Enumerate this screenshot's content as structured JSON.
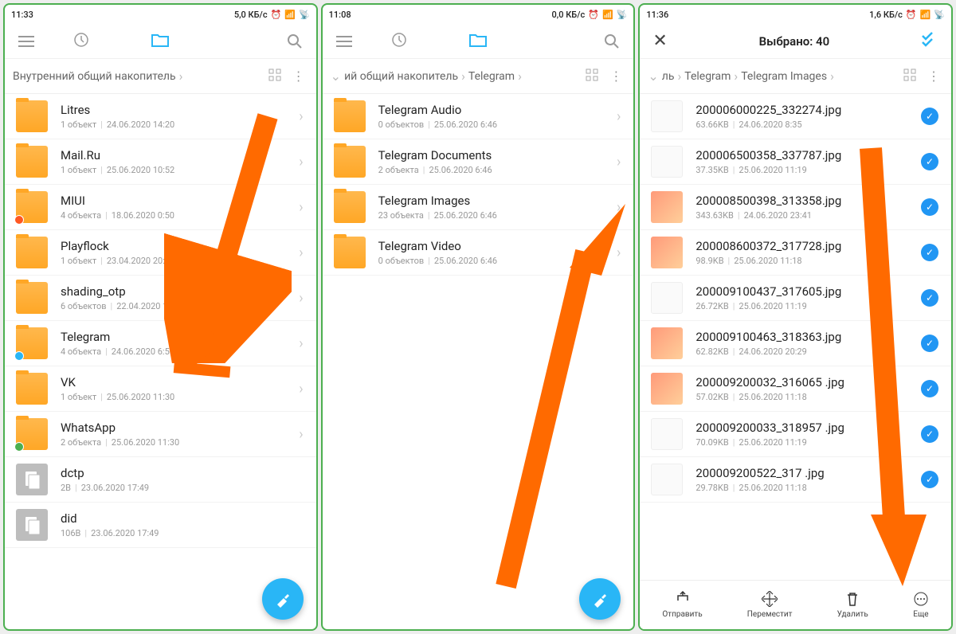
{
  "screens": [
    {
      "status": {
        "time": "11:33",
        "speed": "5,0 КБ/с"
      },
      "breadcrumb": "Внутренний общий накопитель",
      "items": [
        {
          "type": "folder",
          "title": "Litres",
          "sub1": "1 объект",
          "sub2": "24.06.2020 14:20"
        },
        {
          "type": "folder",
          "title": "Mail.Ru",
          "sub1": "1 объект",
          "sub2": "25.06.2020 10:52"
        },
        {
          "type": "folder",
          "badge": "mi",
          "title": "MIUI",
          "sub1": "4 объекта",
          "sub2": "18.06.2020 0:50"
        },
        {
          "type": "folder",
          "title": "Playflock",
          "sub1": "1 объект",
          "sub2": "23.04.2020 20:27"
        },
        {
          "type": "folder",
          "title": "shading_otp",
          "sub1": "6 объектов",
          "sub2": "22.04.2020 14:09"
        },
        {
          "type": "folder",
          "badge": "tg",
          "title": "Telegram",
          "sub1": "4 объекта",
          "sub2": "24.06.2020 6:50"
        },
        {
          "type": "folder",
          "title": "VK",
          "sub1": "1 объект",
          "sub2": "25.06.2020 11:30"
        },
        {
          "type": "folder",
          "badge": "wa",
          "title": "WhatsApp",
          "sub1": "2 объекта",
          "sub2": "25.06.2020 11:30"
        },
        {
          "type": "doc",
          "title": "dctp",
          "sub1": "2B",
          "sub2": "23.06.2020 17:49"
        },
        {
          "type": "doc",
          "title": "did",
          "sub1": "106B",
          "sub2": "23.06.2020 17:49"
        }
      ]
    },
    {
      "status": {
        "time": "11:08",
        "speed": "0,0 КБ/с"
      },
      "bc_parts": [
        "ий общий накопитель",
        "Telegram"
      ],
      "items": [
        {
          "type": "folder",
          "title": "Telegram Audio",
          "sub1": "0 объектов",
          "sub2": "25.06.2020 6:46"
        },
        {
          "type": "folder",
          "title": "Telegram Documents",
          "sub1": "2 объекта",
          "sub2": "25.06.2020 6:46"
        },
        {
          "type": "folder",
          "title": "Telegram Images",
          "sub1": "23 объекта",
          "sub2": "25.06.2020 6:46"
        },
        {
          "type": "folder",
          "title": "Telegram Video",
          "sub1": "0 объектов",
          "sub2": "25.06.2020 6:46"
        }
      ]
    },
    {
      "status": {
        "time": "11:36",
        "speed": "1,6 КБ/с"
      },
      "title": "Выбрано: 40",
      "bc_parts": [
        "ль",
        "Telegram",
        "Telegram Images"
      ],
      "items": [
        {
          "type": "img-white",
          "title": "200006000225_332274.jpg",
          "sub1": "63.66KB",
          "sub2": "24.06.2020 8:35"
        },
        {
          "type": "img-white",
          "title": "200006500358_337787.jpg",
          "sub1": "37.35KB",
          "sub2": "25.06.2020 11:19"
        },
        {
          "type": "img",
          "title": "200008500398_313358.jpg",
          "sub1": "343.63KB",
          "sub2": "24.06.2020 23:41"
        },
        {
          "type": "img",
          "title": "200008600372_317728.jpg",
          "sub1": "98.9KB",
          "sub2": "25.06.2020 11:18"
        },
        {
          "type": "img-white",
          "title": "200009100437_317605.jpg",
          "sub1": "26.72KB",
          "sub2": "25.06.2020 11:19"
        },
        {
          "type": "img",
          "title": "200009100463_318363.jpg",
          "sub1": "62.82KB",
          "sub2": "24.06.2020 20:29"
        },
        {
          "type": "img",
          "title": "200009200032_316065 .jpg",
          "sub1": "57.02KB",
          "sub2": "25.06.2020 11:18"
        },
        {
          "type": "img-white",
          "title": "200009200033_318957 .jpg",
          "sub1": "70.09KB",
          "sub2": "25.06.2020 11:19"
        },
        {
          "type": "img-white",
          "title": "200009200522_317 .jpg",
          "sub1": "29.78KB",
          "sub2": "25.06.2020 11:18"
        }
      ],
      "bottom": {
        "send": "Отправить",
        "move": "Переместит",
        "delete": "Удалить",
        "more": "Еще"
      }
    }
  ]
}
